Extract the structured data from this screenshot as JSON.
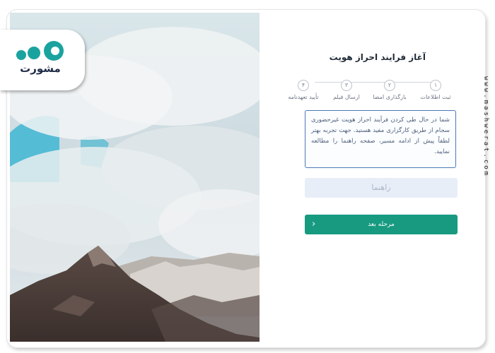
{
  "panel": {
    "title": "آغاز فرایند احراز هویت",
    "steps": [
      {
        "num": "۱",
        "label": "ثبت اطلاعات"
      },
      {
        "num": "۲",
        "label": "بارگذاری امضا"
      },
      {
        "num": "۳",
        "label": "ارسال فیلم"
      },
      {
        "num": "۴",
        "label": "تأیید تعهدنامه"
      }
    ],
    "info_text": "شما در حال طی کردن فرآیند احراز هویت غیرحضوری سجام از طریق کارگزاری مفید هستید. جهت تجربه بهتر لطفاً پیش از ادامه مسیر، صفحه راهنما را مطالعه نمایید.",
    "guide_label": "راهنما",
    "next_label": "مرحله بعد",
    "next_icon": "chevron-left-icon"
  },
  "watermark": {
    "logo_text": "مشورت",
    "site_text": "www.mashwerat.com"
  },
  "colors": {
    "accent": "#179a80",
    "info_border": "#4a78b8",
    "guide_bg": "#e8eef8",
    "logo_dots": "#1aa39e"
  }
}
